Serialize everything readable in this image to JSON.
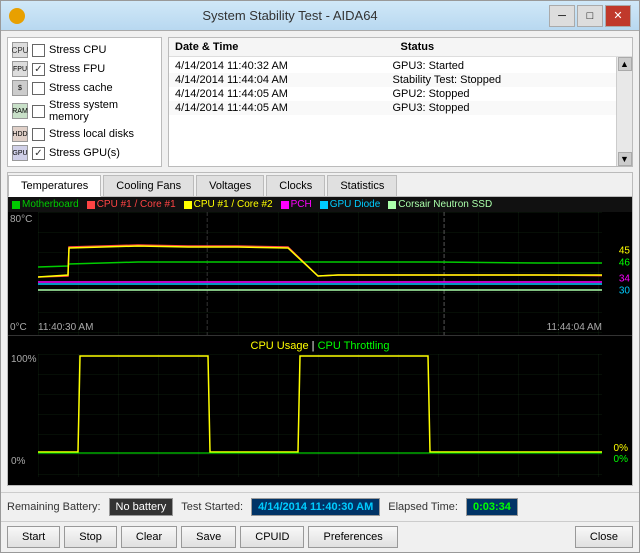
{
  "window": {
    "title": "System Stability Test - AIDA64",
    "icon": "fire-icon"
  },
  "titlebar": {
    "minimize_label": "─",
    "maximize_label": "□",
    "close_label": "✕"
  },
  "stress_items": [
    {
      "id": "cpu",
      "icon": "cpu-icon",
      "label": "Stress CPU",
      "checked": false
    },
    {
      "id": "fpu",
      "icon": "fpu-icon",
      "label": "Stress FPU",
      "checked": true
    },
    {
      "id": "cache",
      "icon": "cache-icon",
      "label": "Stress cache",
      "checked": false
    },
    {
      "id": "memory",
      "icon": "memory-icon",
      "label": "Stress system memory",
      "checked": false
    },
    {
      "id": "disks",
      "icon": "disk-icon",
      "label": "Stress local disks",
      "checked": false
    },
    {
      "id": "gpu",
      "icon": "gpu-icon",
      "label": "Stress GPU(s)",
      "checked": true
    }
  ],
  "log": {
    "headers": [
      "Date & Time",
      "Status"
    ],
    "rows": [
      {
        "datetime": "4/14/2014 11:40:32 AM",
        "status": "GPU3: Started"
      },
      {
        "datetime": "4/14/2014 11:44:04 AM",
        "status": "Stability Test: Stopped"
      },
      {
        "datetime": "4/14/2014 11:44:05 AM",
        "status": "GPU2: Stopped"
      },
      {
        "datetime": "4/14/2014 11:44:05 AM",
        "status": "GPU3: Stopped"
      }
    ]
  },
  "tabs": [
    {
      "id": "temperatures",
      "label": "Temperatures",
      "active": true
    },
    {
      "id": "cooling-fans",
      "label": "Cooling Fans",
      "active": false
    },
    {
      "id": "voltages",
      "label": "Voltages",
      "active": false
    },
    {
      "id": "clocks",
      "label": "Clocks",
      "active": false
    },
    {
      "id": "statistics",
      "label": "Statistics",
      "active": false
    }
  ],
  "temp_chart": {
    "y_max": "80°C",
    "y_min": "0°C",
    "x_start": "11:40:30 AM",
    "x_end": "11:44:04 AM",
    "right_values": [
      "45",
      "46",
      "34",
      "30"
    ],
    "right_colors": [
      "#ffff00",
      "#00ff00",
      "#ff00ff",
      "#00ffff"
    ],
    "legend": [
      {
        "label": "Motherboard",
        "color": "#00cc00"
      },
      {
        "label": "CPU #1 / Core #1",
        "color": "#ff4444"
      },
      {
        "label": "CPU #1 / Core #2",
        "color": "#ffff00"
      },
      {
        "label": "PCH",
        "color": "#ff00ff"
      },
      {
        "label": "GPU Diode",
        "color": "#00ccff"
      },
      {
        "label": "Corsair Neutron SSD",
        "color": "#aaffaa"
      }
    ]
  },
  "cpu_chart": {
    "title_usage": "CPU Usage",
    "title_separator": "|",
    "title_throttling": "CPU Throttling",
    "y_max": "100%",
    "y_min": "0%",
    "right_values_1": [
      "0%",
      "0%"
    ],
    "right_colors_1": [
      "#ffff00",
      "#00ff00"
    ]
  },
  "bottom_bar": {
    "battery_label": "Remaining Battery:",
    "battery_value": "No battery",
    "test_started_label": "Test Started:",
    "test_started_value": "4/14/2014 11:40:30 AM",
    "elapsed_label": "Elapsed Time:",
    "elapsed_value": "0:03:34"
  },
  "action_buttons": [
    {
      "id": "start",
      "label": "Start"
    },
    {
      "id": "stop",
      "label": "Stop"
    },
    {
      "id": "clear",
      "label": "Clear"
    },
    {
      "id": "save",
      "label": "Save"
    },
    {
      "id": "cpuid",
      "label": "CPUID"
    },
    {
      "id": "preferences",
      "label": "Preferences"
    },
    {
      "id": "close",
      "label": "Close"
    }
  ]
}
